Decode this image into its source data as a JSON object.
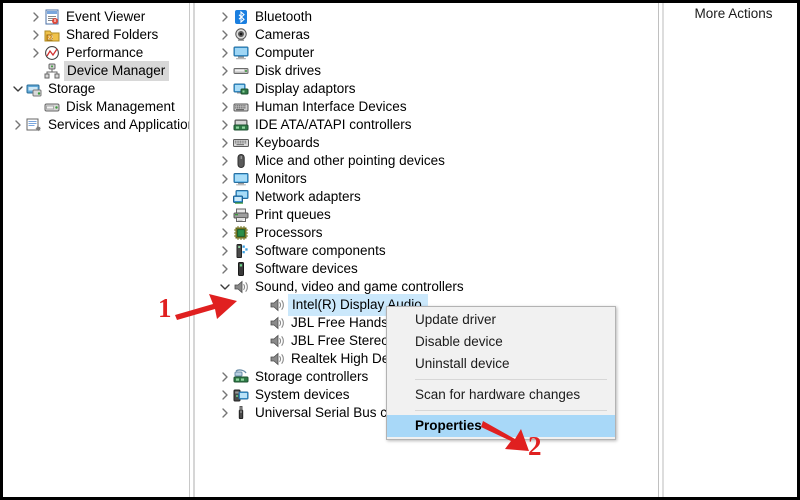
{
  "window": {
    "accent_selection_blue": "#cbe8fb",
    "menu_highlight_blue": "#a8d8f8",
    "annotation_red": "#e02020",
    "selection_gray": "#d8d8d8"
  },
  "left_pane": {
    "items": [
      {
        "label": "Event Viewer",
        "icon": "event-viewer-icon",
        "indent": 26,
        "chevron": "collapsed",
        "selected": false
      },
      {
        "label": "Shared Folders",
        "icon": "shared-folders-icon",
        "indent": 26,
        "chevron": "collapsed",
        "selected": false
      },
      {
        "label": "Performance",
        "icon": "performance-icon",
        "indent": 26,
        "chevron": "collapsed",
        "selected": false
      },
      {
        "label": "Device Manager",
        "icon": "device-manager-icon",
        "indent": 26,
        "chevron": "none",
        "selected": true
      },
      {
        "label": "Storage",
        "icon": "storage-icon",
        "indent": 8,
        "chevron": "expanded",
        "selected": false
      },
      {
        "label": "Disk Management",
        "icon": "disk-management-icon",
        "indent": 26,
        "chevron": "none",
        "selected": false
      },
      {
        "label": "Services and Applications",
        "icon": "services-applications-icon",
        "indent": 8,
        "chevron": "collapsed",
        "selected": false
      }
    ]
  },
  "device_tree": {
    "items": [
      {
        "label": "Bluetooth",
        "icon": "bluetooth-icon",
        "level": 0,
        "chevron": "collapsed",
        "selected": false
      },
      {
        "label": "Cameras",
        "icon": "camera-icon",
        "level": 0,
        "chevron": "collapsed",
        "selected": false
      },
      {
        "label": "Computer",
        "icon": "computer-icon",
        "level": 0,
        "chevron": "collapsed",
        "selected": false
      },
      {
        "label": "Disk drives",
        "icon": "disk-drive-icon",
        "level": 0,
        "chevron": "collapsed",
        "selected": false
      },
      {
        "label": "Display adaptors",
        "icon": "display-adapter-icon",
        "level": 0,
        "chevron": "collapsed",
        "selected": false
      },
      {
        "label": "Human Interface Devices",
        "icon": "hid-icon",
        "level": 0,
        "chevron": "collapsed",
        "selected": false
      },
      {
        "label": "IDE ATA/ATAPI controllers",
        "icon": "ide-controller-icon",
        "level": 0,
        "chevron": "collapsed",
        "selected": false
      },
      {
        "label": "Keyboards",
        "icon": "keyboard-icon",
        "level": 0,
        "chevron": "collapsed",
        "selected": false
      },
      {
        "label": "Mice and other pointing devices",
        "icon": "mouse-icon",
        "level": 0,
        "chevron": "collapsed",
        "selected": false
      },
      {
        "label": "Monitors",
        "icon": "monitor-icon",
        "level": 0,
        "chevron": "collapsed",
        "selected": false
      },
      {
        "label": "Network adapters",
        "icon": "network-adapter-icon",
        "level": 0,
        "chevron": "collapsed",
        "selected": false
      },
      {
        "label": "Print queues",
        "icon": "printer-icon",
        "level": 0,
        "chevron": "collapsed",
        "selected": false
      },
      {
        "label": "Processors",
        "icon": "processor-icon",
        "level": 0,
        "chevron": "collapsed",
        "selected": false
      },
      {
        "label": "Software components",
        "icon": "software-component-icon",
        "level": 0,
        "chevron": "collapsed",
        "selected": false
      },
      {
        "label": "Software devices",
        "icon": "software-device-icon",
        "level": 0,
        "chevron": "collapsed",
        "selected": false
      },
      {
        "label": "Sound, video and game controllers",
        "icon": "speaker-icon",
        "level": 0,
        "chevron": "expanded",
        "selected": false
      },
      {
        "label": "Intel(R) Display Audio",
        "icon": "speaker-icon",
        "level": 1,
        "chevron": "none",
        "selected": true
      },
      {
        "label": "JBL Free Hands-Free",
        "icon": "speaker-icon",
        "level": 1,
        "chevron": "none",
        "selected": false
      },
      {
        "label": "JBL Free Stereo",
        "icon": "speaker-icon",
        "level": 1,
        "chevron": "none",
        "selected": false
      },
      {
        "label": "Realtek High Definit",
        "icon": "speaker-icon",
        "level": 1,
        "chevron": "none",
        "selected": false
      },
      {
        "label": "Storage controllers",
        "icon": "storage-controller-icon",
        "level": 0,
        "chevron": "collapsed",
        "selected": false
      },
      {
        "label": "System devices",
        "icon": "system-device-icon",
        "level": 0,
        "chevron": "collapsed",
        "selected": false
      },
      {
        "label": "Universal Serial Bus con",
        "icon": "usb-icon",
        "level": 0,
        "chevron": "collapsed",
        "selected": false
      }
    ]
  },
  "context_menu": {
    "items": [
      {
        "label": "Update driver",
        "type": "item",
        "highlight": false
      },
      {
        "label": "Disable device",
        "type": "item",
        "highlight": false
      },
      {
        "label": "Uninstall device",
        "type": "item",
        "highlight": false
      },
      {
        "label": "",
        "type": "separator",
        "highlight": false
      },
      {
        "label": "Scan for hardware changes",
        "type": "item",
        "highlight": false
      },
      {
        "label": "",
        "type": "separator",
        "highlight": false
      },
      {
        "label": "Properties",
        "type": "item",
        "highlight": true
      }
    ]
  },
  "right_pane": {
    "title": "More Actions"
  },
  "annotations": [
    {
      "number": "1",
      "points_to": "sound-video-game-controllers-expander"
    },
    {
      "number": "2",
      "points_to": "context-menu-item-properties"
    }
  ]
}
